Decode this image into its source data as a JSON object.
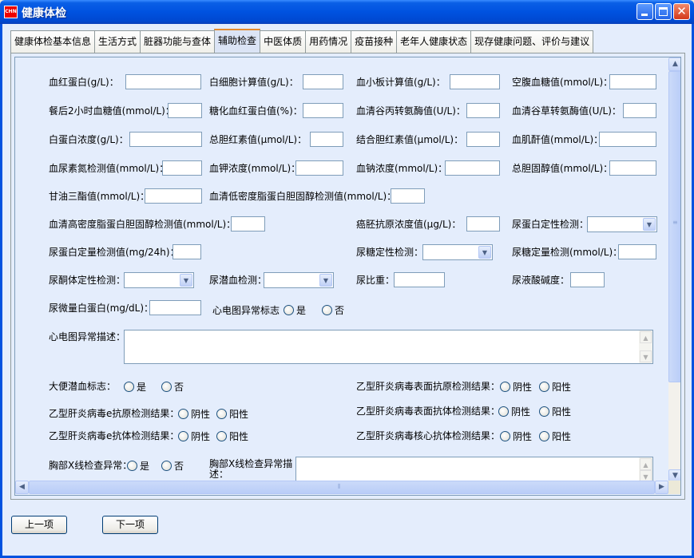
{
  "window": {
    "title": "健康体检",
    "app_icon_text": "CHN"
  },
  "tabs": [
    {
      "label": "健康体检基本信息"
    },
    {
      "label": "生活方式"
    },
    {
      "label": "脏器功能与查体"
    },
    {
      "label": "辅助检查",
      "active": true
    },
    {
      "label": "中医体质"
    },
    {
      "label": "用药情况"
    },
    {
      "label": "疫苗接种"
    },
    {
      "label": "老年人健康状态"
    },
    {
      "label": "现存健康问题、评价与建议"
    }
  ],
  "fields": {
    "hemoglobin": "血红蛋白(g/L)：",
    "wbc": "白细胞计算值(g/L)：",
    "platelet": "血小板计算值(g/L)：",
    "fasting_glucose": "空腹血糖值(mmol/L)：",
    "postprandial_glucose": "餐后2小时血糖值(mmol/L)：",
    "hba1c": "糖化血红蛋白值(%)：",
    "alt": "血清谷丙转氨酶值(U/L)：",
    "ast": "血清谷草转氨酶值(U/L)：",
    "albumin": "白蛋白浓度(g/L)：",
    "total_bilirubin": "总胆红素值(μmol/L)：",
    "direct_bilirubin": "结合胆红素值(μmol/L)：",
    "creatinine": "血肌酐值(mmol/L)：",
    "bun": "血尿素氮检测值(mmol/L)：",
    "potassium": "血钾浓度(mmol/L)：",
    "sodium": "血钠浓度(mmol/L)：",
    "cholesterol": "总胆固醇值(mmol/L)：",
    "triglyceride": "甘油三酯值(mmol/L)：",
    "ldl": "血清低密度脂蛋白胆固醇检测值(mmol/L)：",
    "hdl": "血清高密度脂蛋白胆固醇检测值(mmol/L)：",
    "cea": "癌胚抗原浓度值(μg/L)：",
    "urine_protein_qual": "尿蛋白定性检测：",
    "urine_protein_quant": "尿蛋白定量检测值(mg/24h)：",
    "urine_glucose_qual": "尿糖定性检测：",
    "urine_glucose_quant": "尿糖定量检测(mmol/L)：",
    "urine_ketone": "尿酮体定性检测：",
    "urine_blood": "尿潜血检测：",
    "urine_sg": "尿比重：",
    "urine_ph": "尿液酸碱度：",
    "urine_microalbumin": "尿微量白蛋白(mg/dL)：",
    "ecg_abnormal": "心电图异常标志",
    "ecg_desc": "心电图异常描述：",
    "fecal_blood": "大便潜血标志：",
    "hbsag": "乙型肝炎病毒表面抗原检测结果：",
    "hbeag": "乙型肝炎病毒e抗原检测结果：",
    "hbsab": "乙型肝炎病毒表面抗体检测结果：",
    "hbeab": "乙型肝炎病毒e抗体检测结果：",
    "hbcab": "乙型肝炎病毒核心抗体检测结果：",
    "xray_abnormal": "胸部X线检查异常：",
    "xray_desc_1": "胸部X线检查异常描",
    "xray_desc_2": "述："
  },
  "options": {
    "yes": "是",
    "no": "否",
    "negative": "阴性",
    "positive": "阳性"
  },
  "buttons": {
    "prev": "上一项",
    "next": "下一项"
  }
}
